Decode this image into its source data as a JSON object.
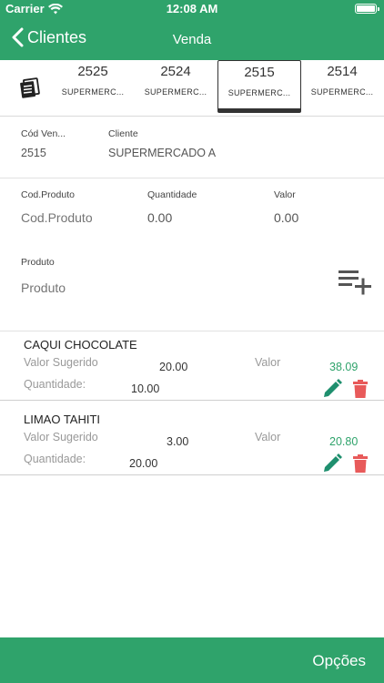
{
  "status_bar": {
    "carrier": "Carrier",
    "time": "12:08 AM"
  },
  "nav": {
    "back_label": "Clientes",
    "title": "Venda"
  },
  "tabs": [
    {
      "number": "2525",
      "name": "SUPERMERC...",
      "active": false
    },
    {
      "number": "2524",
      "name": "SUPERMERC...",
      "active": false
    },
    {
      "number": "2515",
      "name": "SUPERMERC...",
      "active": true
    },
    {
      "number": "2514",
      "name": "SUPERMERC...",
      "active": false
    }
  ],
  "header_fields": {
    "cod_vend_label": "Cód Ven...",
    "cod_vend_value": "2515",
    "cliente_label": "Cliente",
    "cliente_value": "SUPERMERCADO A"
  },
  "entry": {
    "cod_produto_label": "Cod.Produto",
    "cod_produto_placeholder": "Cod.Produto",
    "quantidade_label": "Quantidade",
    "quantidade_value": "0.00",
    "valor_label": "Valor",
    "valor_value": "0.00",
    "produto_label": "Produto",
    "produto_placeholder": "Produto"
  },
  "items": [
    {
      "name": "CAQUI CHOCOLATE",
      "valor_sugerido_label": "Valor Sugerido",
      "valor_sugerido": "20.00",
      "valor_label": "Valor",
      "valor": "38.09",
      "quantidade_label": "Quantidade:",
      "quantidade": "10.00"
    },
    {
      "name": "LIMAO TAHITI",
      "valor_sugerido_label": "Valor Sugerido",
      "valor_sugerido": "3.00",
      "valor_label": "Valor",
      "valor": "20.80",
      "quantidade_label": "Quantidade:",
      "quantidade": "20.00"
    }
  ],
  "footer": {
    "options_label": "Opções"
  },
  "colors": {
    "primary": "#2fa36b",
    "edit": "#1e8f6e",
    "delete": "#e85a5a"
  }
}
